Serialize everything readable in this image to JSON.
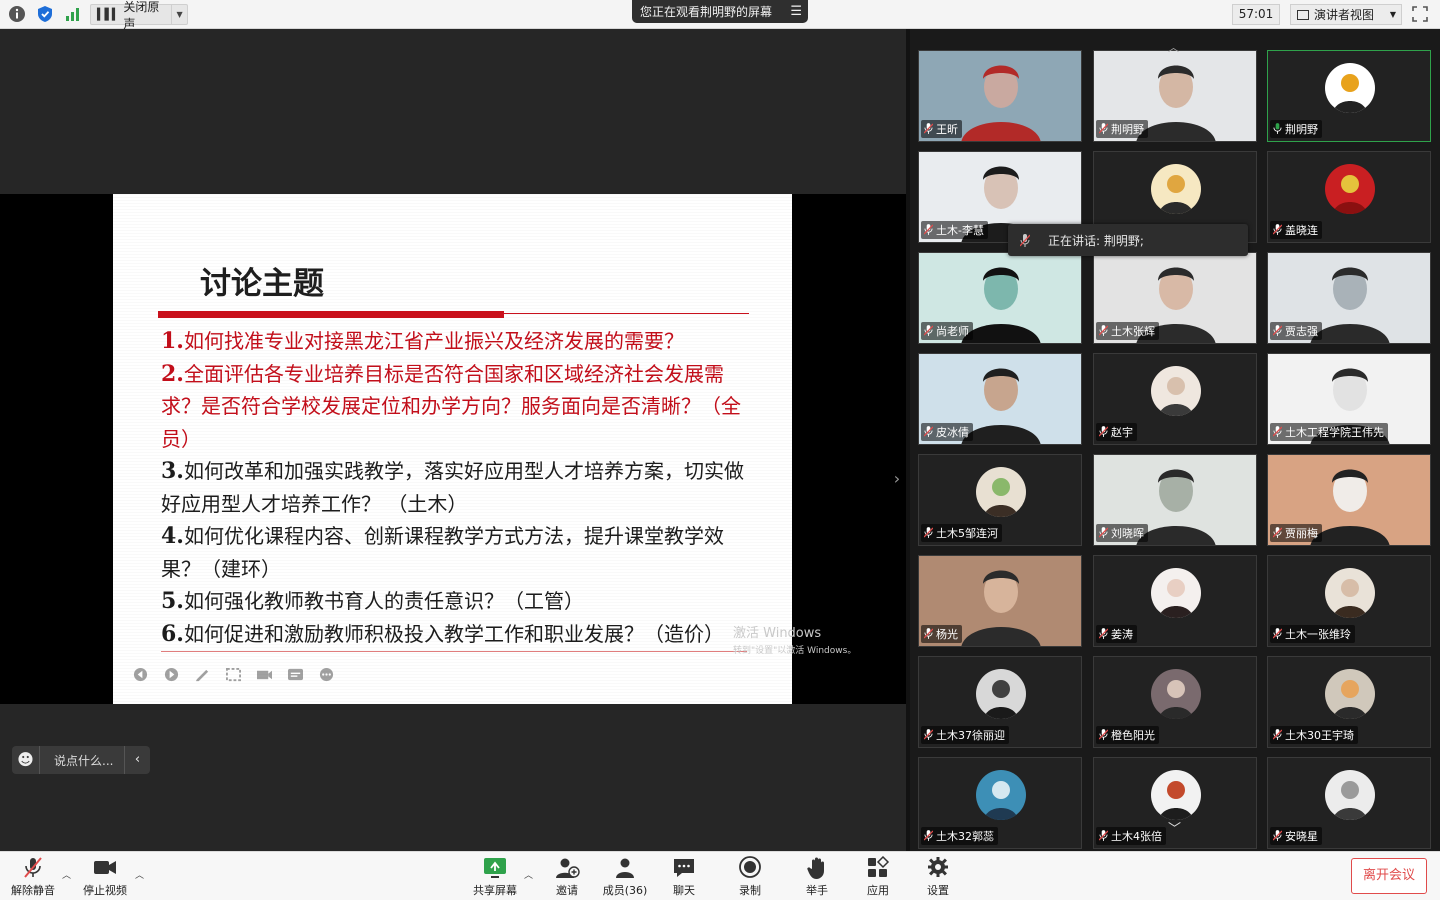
{
  "topbar": {
    "audio_label": "关闭原声",
    "share_banner": "您正在观看荆明野的屏幕",
    "timer": "57:01",
    "view_label": "演讲者视图"
  },
  "slide": {
    "title": "讨论主题",
    "topics": [
      {
        "num": "1.",
        "text": "如何找准专业对接黑龙江省产业振兴及经济发展的需要？",
        "red": true
      },
      {
        "num": "2.",
        "text": "全面评估各专业培养目标是否符合国家和区域经济社会发展需求？是否符合学校发展定位和办学方向？服务面向是否清晰？（全员）",
        "red": true
      },
      {
        "num": "3.",
        "text": "如何改革和加强实践教学，落实好应用型人才培养方案，切实做好应用型人才培养工作？ （土木）",
        "red": false
      },
      {
        "num": "4.",
        "text": "如何优化课程内容、创新课程教学方式方法，提升课堂教学效果？（建环）",
        "red": false
      },
      {
        "num": "5.",
        "text": "如何强化教师教书育人的责任意识？（工管）",
        "red": false
      },
      {
        "num": "6.",
        "text": "如何促进和激励教师积极投入教学工作和职业发展？（造价）",
        "red": false
      }
    ],
    "watermark_title": "激活 Windows",
    "watermark_sub": "转到\"设置\"以激活 Windows。"
  },
  "chat": {
    "placeholder": "说点什么..."
  },
  "speaking": {
    "label": "正在讲话: 荆明野;"
  },
  "participants": [
    {
      "name": "王昕",
      "kind": "video",
      "colors": [
        "#8ea7b5",
        "#c9a9a0",
        "#b22a28"
      ]
    },
    {
      "name": "荆明野",
      "kind": "video",
      "colors": [
        "#e4e6e8",
        "#d4b7a4",
        "#2b2b2b"
      ]
    },
    {
      "name": "荆明野",
      "kind": "avatar",
      "active": true,
      "colors": [
        "#ffffff",
        "#e8a21c",
        "#222222"
      ]
    },
    {
      "name": "土木-李慧",
      "kind": "video",
      "colors": [
        "#e9ecef",
        "#d8c2b6",
        "#1c1c1c"
      ]
    },
    {
      "name": "",
      "kind": "avatar",
      "colors": [
        "#f6e8c2",
        "#e0a640",
        "#2a2a2a"
      ]
    },
    {
      "name": "盖晓连",
      "kind": "avatar",
      "colors": [
        "#c91f22",
        "#e5c23c",
        "#8a1010"
      ]
    },
    {
      "name": "尚老师",
      "kind": "video",
      "colors": [
        "#cfe7e3",
        "#7db7ad",
        "#111111"
      ]
    },
    {
      "name": "土木张辉",
      "kind": "video",
      "colors": [
        "#e3e3e3",
        "#d8b9a6",
        "#2b2b2b"
      ]
    },
    {
      "name": "贾志强",
      "kind": "video",
      "colors": [
        "#dfe3e6",
        "#a9b2b8",
        "#2a2a2a"
      ]
    },
    {
      "name": "皮冰倩",
      "kind": "video",
      "colors": [
        "#cfe0ea",
        "#c7a58e",
        "#1f1f1f"
      ]
    },
    {
      "name": "赵宇",
      "kind": "avatar",
      "colors": [
        "#efe7df",
        "#d8c0ad",
        "#3a3a3a"
      ]
    },
    {
      "name": "土木工程学院王伟先",
      "kind": "video",
      "colors": [
        "#f2f2f2",
        "#e2e2e2",
        "#2a2a2a"
      ]
    },
    {
      "name": "土木5邹连河",
      "kind": "avatar",
      "colors": [
        "#e8e0d2",
        "#8ab86b",
        "#3b2e25"
      ]
    },
    {
      "name": "刘晓晖",
      "kind": "video",
      "colors": [
        "#dfe3e0",
        "#a7b0a6",
        "#2a2a2a"
      ]
    },
    {
      "name": "贾丽梅",
      "kind": "video",
      "colors": [
        "#d8a383",
        "#f0ece8",
        "#222222"
      ]
    },
    {
      "name": "杨光",
      "kind": "video",
      "colors": [
        "#b08a72",
        "#d7b49b",
        "#2b2b2b"
      ]
    },
    {
      "name": "姜涛",
      "kind": "avatar",
      "colors": [
        "#f4f0ee",
        "#e8cfc3",
        "#2a2020"
      ]
    },
    {
      "name": "土木一张维玲",
      "kind": "avatar",
      "colors": [
        "#e9e2d8",
        "#d7bda8",
        "#3a2b20"
      ]
    },
    {
      "name": "土木37徐丽迎",
      "kind": "avatar",
      "colors": [
        "#d8d8d8",
        "#404040",
        "#1a1a1a"
      ]
    },
    {
      "name": "橙色阳光",
      "kind": "avatar",
      "colors": [
        "#7a6a6e",
        "#d7c3b8",
        "#2a2a2a"
      ]
    },
    {
      "name": "土木30王宇琦",
      "kind": "avatar",
      "colors": [
        "#d0c8bb",
        "#e6a55e",
        "#2a2a2a"
      ]
    },
    {
      "name": "土木32郭蕊",
      "kind": "avatar",
      "colors": [
        "#3d8fb6",
        "#d5e8f0",
        "#1f3a52"
      ]
    },
    {
      "name": "土木4张倍",
      "kind": "avatar",
      "colors": [
        "#f2f2f2",
        "#c34a2c",
        "#1d1d1d"
      ]
    },
    {
      "name": "安晓星",
      "kind": "avatar",
      "colors": [
        "#ececec",
        "#9a9a9a",
        "#3a3a3a"
      ]
    }
  ],
  "toolbar": {
    "unmute": "解除静音",
    "stop_video": "停止视频",
    "share_screen": "共享屏幕",
    "invite": "邀请",
    "members": "成员(36)",
    "chat": "聊天",
    "record": "录制",
    "raise_hand": "举手",
    "apps": "应用",
    "settings": "设置",
    "leave": "离开会议"
  },
  "colors": {
    "accent_green": "#2fa24b",
    "leave_red": "#e04b4b",
    "slide_red": "#c20e1a"
  }
}
